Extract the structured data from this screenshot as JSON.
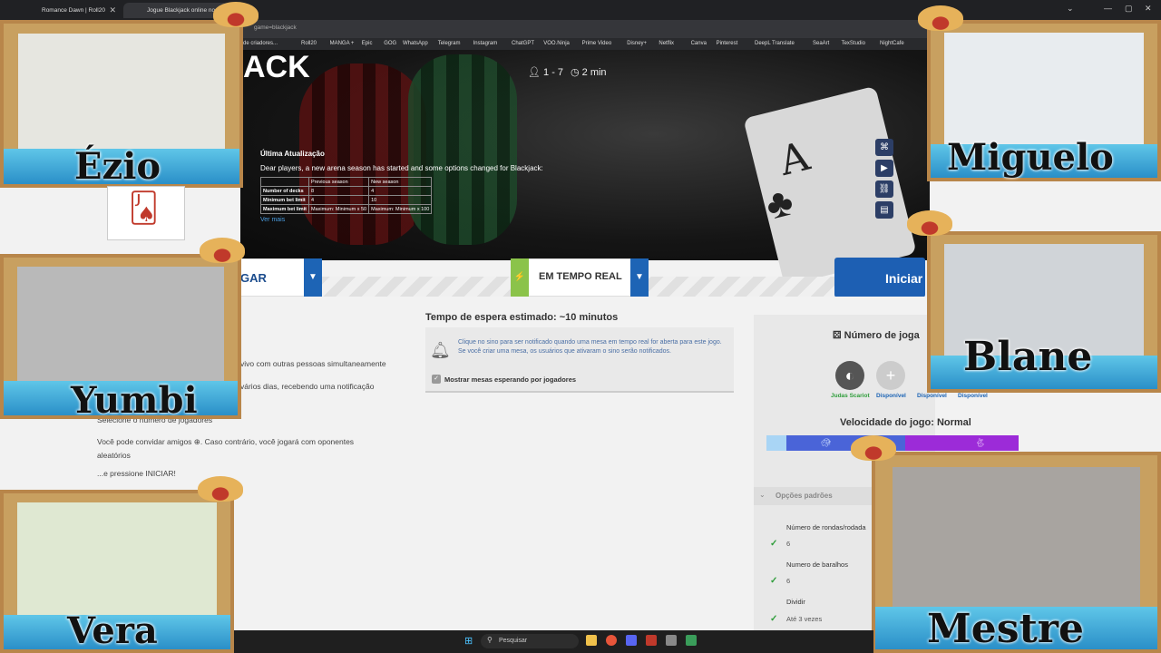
{
  "browser": {
    "tabs": [
      {
        "label": "Romance Dawn | Roll20"
      },
      {
        "label": "Jogue Blackjack online no..."
      }
    ],
    "url": "game=blackjack",
    "bookmarks": [
      "de criadores...",
      "Roll20",
      "MANGA +",
      "Epic",
      "GOG",
      "WhatsApp",
      "Telegram",
      "Instagram",
      "ChatGPT",
      "VOO.Ninja",
      "Prime Video",
      "Disney+",
      "Netflix",
      "Canva",
      "Pinterest",
      "DeepL Translate",
      "SeaArt",
      "TexStudio",
      "NightCafe"
    ]
  },
  "hero": {
    "logo": "ACK",
    "players": "1 - 7",
    "duration": "2 min",
    "update_title": "Última Atualização",
    "update_text": "Dear players, a new arena season has started and some options changed for Blackjack:",
    "table": {
      "headers": [
        "",
        "Previous season",
        "New season"
      ],
      "rows": [
        [
          "Number of decks",
          "8",
          "4"
        ],
        [
          "Minimum bet limit",
          "4",
          "10"
        ],
        [
          "Maximum bet limit",
          "Maximum: Minimum x 50",
          "Maximum: Minimum x 100"
        ]
      ]
    },
    "see_more": "Ver mais"
  },
  "modes": {
    "tab1": "GAR",
    "tab2": "EM TEMPO REAL",
    "start": "Iniciar"
  },
  "main": {
    "wait_title": "Tempo de espera estimado: ~10 minutos",
    "notif_text": "Clique no sino para ser notificado quando uma mesa em tempo real for aberta para este jogo. Se você criar uma mesa, os usuários que ativaram o sino serão notificados.",
    "checkbox_label": "Mostrar mesas esperando por jogadores"
  },
  "instructions": {
    "line1": "vivo com outras pessoas simultaneamente",
    "line2": "vários dias, recebendo uma notificação",
    "line3": "Selecione o número de jogadores",
    "line4": "Você pode convidar amigos ⊕. Caso contrário, você jogará com oponentes aleatórios",
    "line5": "...e pressione INICIAR!"
  },
  "panel": {
    "players_title": "Número de joga",
    "players": [
      "Judas Scariot",
      "Disponível",
      "Disponível",
      "Disponível"
    ],
    "speed_title": "Velocidade do jogo: Normal",
    "options_label": "Opções padrões",
    "options": [
      {
        "label": "Número de rondas/rodada",
        "value": "6"
      },
      {
        "label": "Numero de baralhos",
        "value": "6"
      },
      {
        "label": "Dividir",
        "value": "Até 3 vezes"
      }
    ]
  },
  "streamers": [
    "Ézio",
    "Miguelo",
    "Yumbi",
    "Blane",
    "Vera",
    "Mestre"
  ],
  "taskbar": {
    "search": "Pesquisar"
  },
  "colors": {
    "accent": "#1d64b5",
    "lime": "#8bc34a",
    "frame": "#c8a060"
  }
}
